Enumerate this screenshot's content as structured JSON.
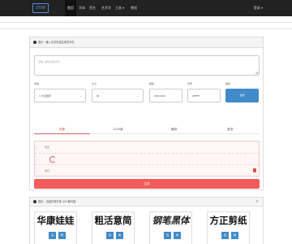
{
  "navbar": {
    "logo": "QT86",
    "items": [
      {
        "label": "首页",
        "active": true
      },
      {
        "label": "字体",
        "active": false
      },
      {
        "label": "签名",
        "active": false
      },
      {
        "label": "艺术字",
        "active": false
      },
      {
        "label": "工具 ▾",
        "active": false
      },
      {
        "label": "教程",
        "active": false
      }
    ],
    "user": "登录 ▾"
  },
  "generator": {
    "header": "提示：输入文字在线生成艺术字",
    "text_placeholder": "请输入要生成的文字",
    "fields": [
      {
        "label": "字体",
        "value": "1.方正粗宋"
      },
      {
        "label": "大小",
        "value": "中"
      },
      {
        "label": "颜色",
        "value": "#000000"
      },
      {
        "label": "背景",
        "value": "#ffffff"
      },
      {
        "label": "操作",
        "value": "生成"
      }
    ],
    "tabs": [
      "效果",
      "2025款",
      "横排",
      "竖排"
    ],
    "active_tab": 0,
    "rows": [
      {
        "label": "预览"
      },
      {
        "label": ""
      },
      {
        "label": "保存"
      }
    ],
    "submit": "生成"
  },
  "fonts_panel": {
    "header": "提示：当前共有字体 423 款可选",
    "close": "×",
    "cards": [
      {
        "preview": "华康娃娃",
        "buttons": [
          "选",
          "看"
        ]
      },
      {
        "preview": "粗活意简",
        "buttons": [
          "选",
          "看"
        ]
      },
      {
        "preview": "钢笔黑体",
        "buttons": [
          "选",
          "看"
        ]
      },
      {
        "preview": "方正剪纸",
        "buttons": [
          "选",
          "看"
        ]
      }
    ]
  },
  "colors": {
    "navbar_bg": "#222222",
    "primary": "#428bca",
    "danger": "#f25c5c"
  }
}
